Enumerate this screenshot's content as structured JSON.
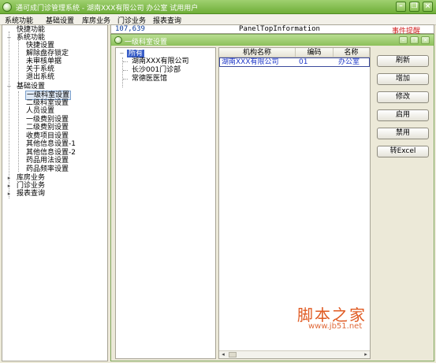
{
  "window": {
    "title": "通可成门诊管理系统 - 湖南XXX有限公司 办公室 试用用户",
    "controls": [
      "minimize",
      "restore",
      "close"
    ]
  },
  "menu": [
    "系统功能",
    "基础设置",
    "库房业务",
    "门诊业务",
    "报表查询"
  ],
  "nav_tree": [
    {
      "label": "快捷功能",
      "level": 0,
      "toggle": ""
    },
    {
      "label": "系统功能",
      "level": 0,
      "toggle": "-"
    },
    {
      "label": "快捷设置",
      "level": 1
    },
    {
      "label": "解除盘存锁定",
      "level": 1
    },
    {
      "label": "未审核单据",
      "level": 1
    },
    {
      "label": "关于系统",
      "level": 1
    },
    {
      "label": "退出系统",
      "level": 1
    },
    {
      "label": "基础设置",
      "level": 0,
      "toggle": "-"
    },
    {
      "label": "一级科室设置",
      "level": 1,
      "selected": true
    },
    {
      "label": "二级科室设置",
      "level": 1
    },
    {
      "label": "人员设置",
      "level": 1
    },
    {
      "label": "一级费别设置",
      "level": 1
    },
    {
      "label": "二级费别设置",
      "level": 1
    },
    {
      "label": "收费项目设置",
      "level": 1
    },
    {
      "label": "其他信息设置-1",
      "level": 1
    },
    {
      "label": "其他信息设置-2",
      "level": 1
    },
    {
      "label": "药品用法设置",
      "level": 1
    },
    {
      "label": "药品频率设置",
      "level": 1
    },
    {
      "label": "库房业务",
      "level": 0,
      "toggle": "+"
    },
    {
      "label": "门诊业务",
      "level": 0,
      "toggle": "+"
    },
    {
      "label": "报表查询",
      "level": 0,
      "toggle": "+"
    }
  ],
  "info_strip": {
    "counter": "107,639",
    "panel_info": "PanelTopInformation",
    "reminder": "事件提醒"
  },
  "child_window": {
    "title": "一级科室设置",
    "unit_tree": {
      "root": "所有",
      "items": [
        "湖南XXX有限公司",
        "长沙001门诊部",
        "常德医医馆"
      ]
    },
    "grid": {
      "columns": [
        "机构名称",
        "编码",
        "名称"
      ],
      "rows": [
        {
          "org": "湖南XXX有限公司",
          "code": "01",
          "name": "办公室"
        }
      ]
    },
    "buttons": [
      "刷新",
      "增加",
      "修改",
      "启用",
      "禁用",
      "转Excel"
    ]
  },
  "watermark": {
    "text": "脚本之家",
    "url": "www.jb51.net"
  },
  "colors": {
    "title_bar": "#6fae38",
    "reminder": "#d02020",
    "grid_link": "#1a34c8",
    "watermark": "#e05a22"
  }
}
